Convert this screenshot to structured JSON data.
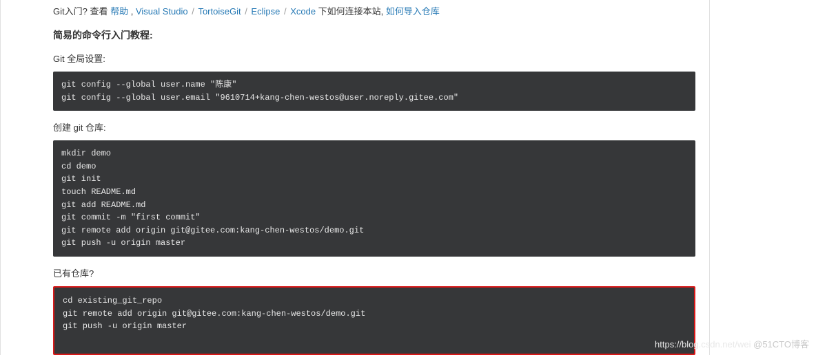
{
  "intro": {
    "prefix": "Git入门? 查看 ",
    "link1": "帮助",
    "comma": " , ",
    "link2": "Visual Studio",
    "link3": "TortoiseGit",
    "link4": "Eclipse",
    "link5": "Xcode",
    "mid": " 下如何连接本站, ",
    "link6": "如何导入仓库",
    "separator": " / "
  },
  "section_title": "简易的命令行入门教程:",
  "block1": {
    "title": "Git 全局设置:",
    "code": "git config --global user.name \"陈康\"\ngit config --global user.email \"9610714+kang-chen-westos@user.noreply.gitee.com\""
  },
  "block2": {
    "title": "创建 git 仓库:",
    "code": "mkdir demo\ncd demo\ngit init\ntouch README.md\ngit add README.md\ngit commit -m \"first commit\"\ngit remote add origin git@gitee.com:kang-chen-westos/demo.git\ngit push -u origin master"
  },
  "block3": {
    "title": "已有仓库?",
    "code": "cd existing_git_repo\ngit remote add origin git@gitee.com:kang-chen-westos/demo.git\ngit push -u origin master"
  },
  "watermark": {
    "faint": "https://blog.csdn.net/wei ",
    "main": "@51CTO博客"
  }
}
